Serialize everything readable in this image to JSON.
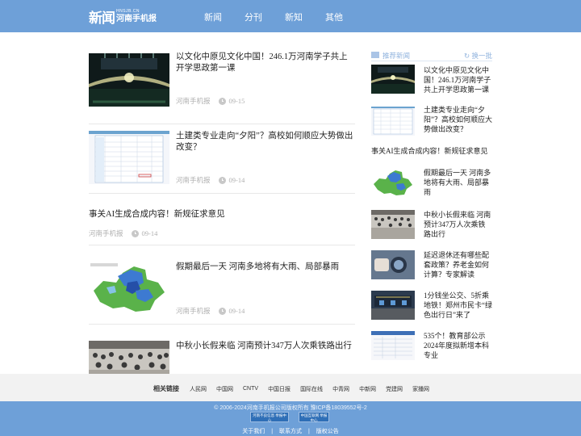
{
  "header": {
    "logo_mark": "新闻",
    "logo_en": "HNSJB.CN",
    "logo_cn": "河南手机报",
    "nav": [
      "新闻",
      "分刊",
      "新知",
      "其他"
    ]
  },
  "articles": [
    {
      "title": "以文化中原见文化中国！246.1万河南学子共上开学思政第一课",
      "source": "河南手机报",
      "date": "09-15"
    },
    {
      "title": "土建类专业走向“夕阳”？高校如何顺应大势做出改变？",
      "source": "河南手机报",
      "date": "09-14"
    },
    {
      "title": "事关AI生成合成内容！新规征求意见",
      "source": "河南手机报",
      "date": "09-14"
    },
    {
      "title": "假期最后一天 河南多地将有大雨、局部暴雨",
      "source": "河南手机报",
      "date": "09-14"
    },
    {
      "title": "中秋小长假来临 河南预计347万人次乘铁路出行"
    }
  ],
  "sidebar": {
    "heading": "推荐新闻",
    "refresh": "换一批",
    "items": [
      {
        "title": "以文化中原见文化中国！246.1万河南学子共上开学思政第一课"
      },
      {
        "title": "土建类专业走向“夕阳”？高校如何顺应大势做出改变？"
      },
      {
        "title": "事关AI生成合成内容！新规征求意见"
      },
      {
        "title": "假期最后一天 河南多地将有大雨、局部暴雨"
      },
      {
        "title": "中秋小长假来临 河南预计347万人次乘铁路出行"
      },
      {
        "title": "延迟退休还有哪些配套政策？养老金如何计算？专家解读"
      },
      {
        "title": "1分钱坐公交、5折乘地铁！郑州市民卡“绿色出行日”来了"
      },
      {
        "title": "535个！教育部公示2024年度拟新增本科专业"
      }
    ]
  },
  "links": {
    "heading": "相关链接",
    "items": [
      "人民网",
      "中国网",
      "CNTV",
      "中国日报",
      "国际在线",
      "中青网",
      "中新网",
      "党建网",
      "家播网"
    ]
  },
  "footer": {
    "copyright": "© 2006-2024河南手机报公司版权所有 豫ICP备18039552号-2",
    "badge1": "河南不良信息 举报中心",
    "badge2": "中国互联网 举报中心",
    "links": [
      "关于我们",
      "联系方式",
      "版权公告"
    ],
    "separator": "|"
  },
  "colors": {
    "header_bg": "#6ea0d8",
    "accent": "#8fb2dd",
    "meta": "#b0b0b0"
  }
}
